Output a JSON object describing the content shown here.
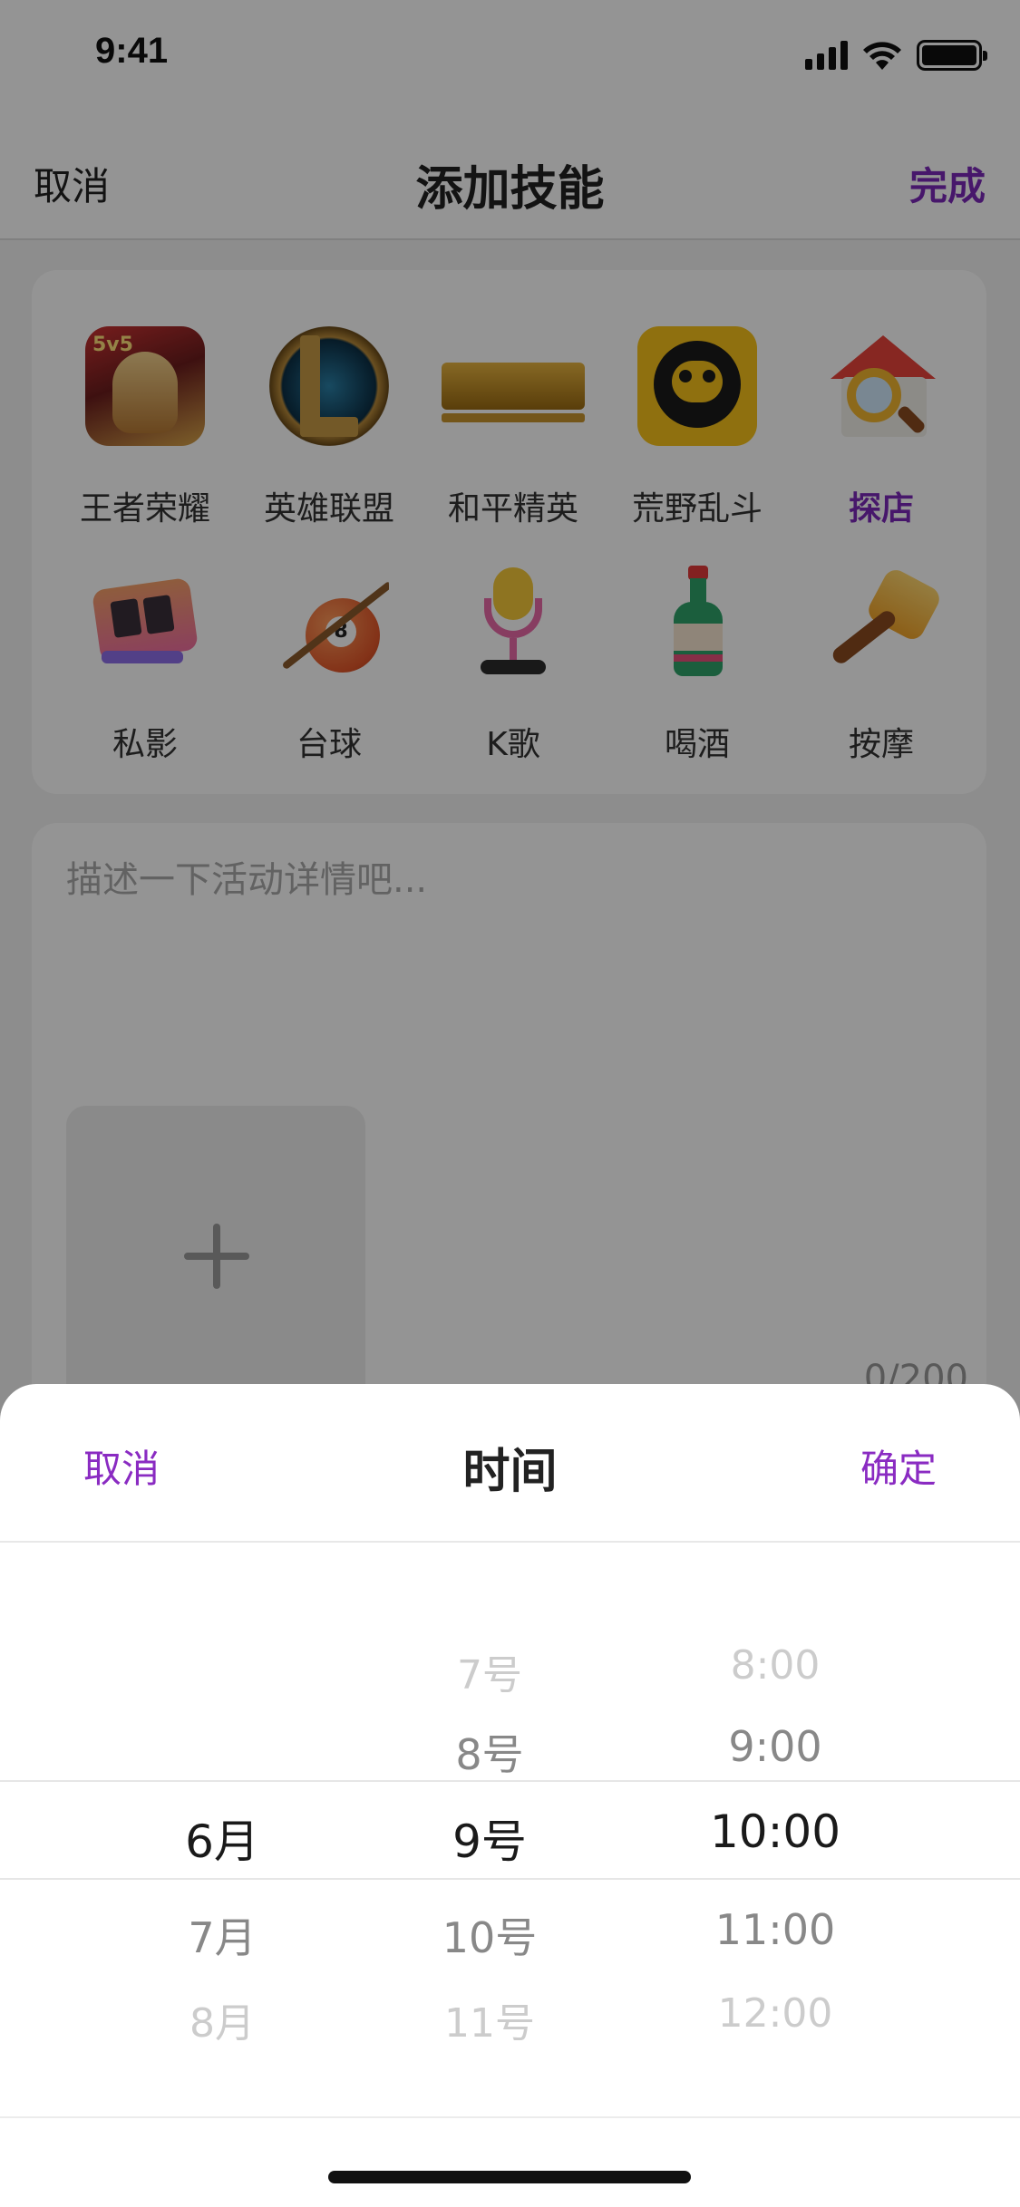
{
  "status_bar": {
    "time": "9:41",
    "icons": [
      "signal-icon",
      "wifi-icon",
      "battery-icon"
    ]
  },
  "nav": {
    "cancel": "取消",
    "title": "添加技能",
    "done": "完成",
    "accent_color": "#7b28b8"
  },
  "skills": [
    {
      "label": "王者荣耀",
      "icon": "honor-of-kings-icon",
      "selected": false
    },
    {
      "label": "英雄联盟",
      "icon": "league-of-legends-icon",
      "selected": false
    },
    {
      "label": "和平精英",
      "icon": "peace-elite-icon",
      "selected": false
    },
    {
      "label": "荒野乱斗",
      "icon": "brawl-stars-icon",
      "selected": false
    },
    {
      "label": "探店",
      "icon": "shop-explore-icon",
      "selected": true
    },
    {
      "label": "私影",
      "icon": "private-cinema-icon",
      "selected": false
    },
    {
      "label": "台球",
      "icon": "billiards-icon",
      "selected": false
    },
    {
      "label": "K歌",
      "icon": "karaoke-mic-icon",
      "selected": false
    },
    {
      "label": "喝酒",
      "icon": "drinking-bottle-icon",
      "selected": false
    },
    {
      "label": "按摩",
      "icon": "massage-hammer-icon",
      "selected": false
    }
  ],
  "description": {
    "placeholder": "描述一下活动详情吧...",
    "counter": "0/200",
    "upload_icon": "plus-icon"
  },
  "sheet": {
    "cancel": "取消",
    "title": "时间",
    "confirm": "确定",
    "accent_color": "#8a2bc2",
    "month": {
      "above": [],
      "selected": "6月",
      "below": [
        "7月",
        "8月"
      ]
    },
    "day": {
      "above": [
        "7号",
        "8号"
      ],
      "selected": "9号",
      "below": [
        "10号",
        "11号"
      ]
    },
    "time": {
      "above": [
        "8:00",
        "9:00"
      ],
      "selected": "10:00",
      "below": [
        "11:00",
        "12:00"
      ]
    }
  }
}
